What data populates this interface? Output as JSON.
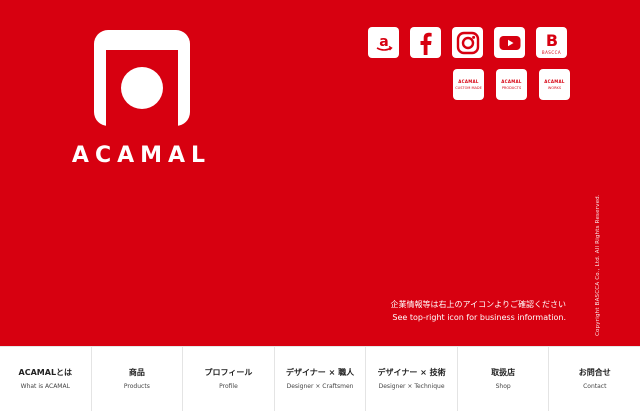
{
  "colors": {
    "brand": "#d70010",
    "white": "#ffffff",
    "text_dark": "#222222"
  },
  "logo": {
    "text": "ACAMAL",
    "mark_icon": "acamal-mark-icon"
  },
  "social": [
    {
      "name": "amazon",
      "icon": "amazon-icon"
    },
    {
      "name": "facebook",
      "icon": "facebook-icon"
    },
    {
      "name": "instagram",
      "icon": "instagram-icon"
    },
    {
      "name": "youtube",
      "icon": "youtube-icon"
    },
    {
      "name": "bascca",
      "icon": "bascca-icon",
      "label": "BASCCA"
    }
  ],
  "sub_links": [
    {
      "logo": "ACAMAL",
      "label": "CUSTOM MADE"
    },
    {
      "logo": "ACAMAL",
      "label": "PRODUCTS"
    },
    {
      "logo": "ACAMAL",
      "label": "WORKS"
    }
  ],
  "info": {
    "jp": "企業情報等は右上のアイコンよりご確認ください",
    "en": "See top-right icon for business information."
  },
  "copyright": "Copyright BASCCA Co., Ltd. All Rights Reserved.",
  "nav": [
    {
      "jp": "ACAMALとは",
      "en": "What is ACAMAL"
    },
    {
      "jp": "商品",
      "en": "Products"
    },
    {
      "jp": "プロフィール",
      "en": "Profile"
    },
    {
      "jp": "デザイナー × 職人",
      "en": "Designer × Craftsmen"
    },
    {
      "jp": "デザイナー × 技術",
      "en": "Designer × Technique"
    },
    {
      "jp": "取扱店",
      "en": "Shop"
    },
    {
      "jp": "お問合せ",
      "en": "Contact"
    }
  ]
}
